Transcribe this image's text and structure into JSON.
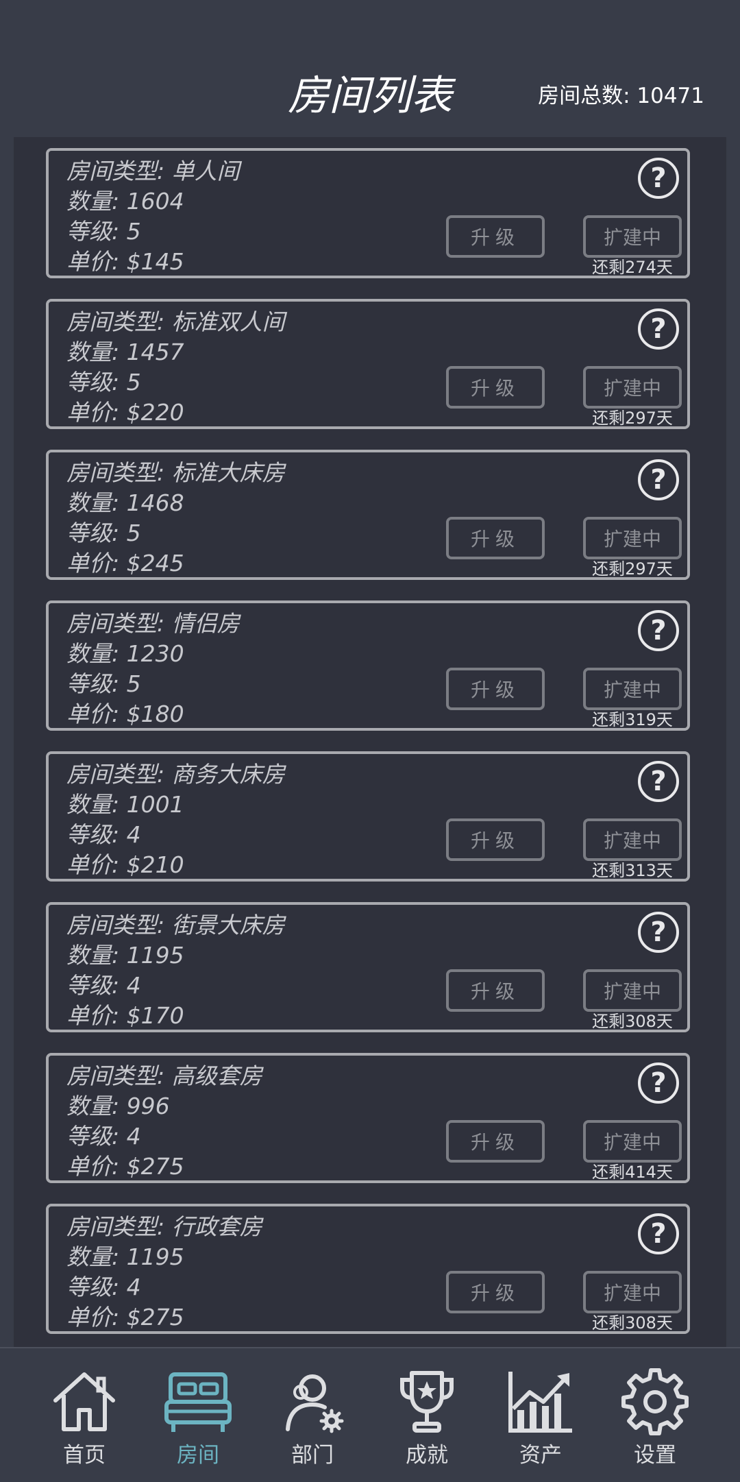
{
  "header": {
    "title": "房间列表",
    "total_text": "房间总数: 10471"
  },
  "buttons": {
    "help": "?",
    "upgrade": "升级",
    "expanding": "扩建中"
  },
  "rooms": [
    {
      "type": "房间类型: 单人间",
      "count": "数量: 1604",
      "level": "等级: 5",
      "price": "单价: $145",
      "days": "还剩274天"
    },
    {
      "type": "房间类型: 标准双人间",
      "count": "数量: 1457",
      "level": "等级: 5",
      "price": "单价: $220",
      "days": "还剩297天"
    },
    {
      "type": "房间类型: 标准大床房",
      "count": "数量: 1468",
      "level": "等级: 5",
      "price": "单价: $245",
      "days": "还剩297天"
    },
    {
      "type": "房间类型: 情侣房",
      "count": "数量: 1230",
      "level": "等级: 5",
      "price": "单价: $180",
      "days": "还剩319天"
    },
    {
      "type": "房间类型: 商务大床房",
      "count": "数量: 1001",
      "level": "等级: 4",
      "price": "单价: $210",
      "days": "还剩313天"
    },
    {
      "type": "房间类型: 街景大床房",
      "count": "数量: 1195",
      "level": "等级: 4",
      "price": "单价: $170",
      "days": "还剩308天"
    },
    {
      "type": "房间类型: 高级套房",
      "count": "数量: 996",
      "level": "等级: 4",
      "price": "单价: $275",
      "days": "还剩414天"
    },
    {
      "type": "房间类型: 行政套房",
      "count": "数量: 1195",
      "level": "等级: 4",
      "price": "单价: $275",
      "days": "还剩308天"
    }
  ],
  "nav": [
    {
      "label": "首页",
      "icon": "home-icon",
      "active": false
    },
    {
      "label": "房间",
      "icon": "bed-icon",
      "active": true
    },
    {
      "label": "部门",
      "icon": "department-icon",
      "active": false
    },
    {
      "label": "成就",
      "icon": "trophy-icon",
      "active": false
    },
    {
      "label": "资产",
      "icon": "assets-chart-icon",
      "active": false
    },
    {
      "label": "设置",
      "icon": "gear-icon",
      "active": false
    }
  ],
  "colors": {
    "background": "#383c48",
    "panel": "#2f313c",
    "active_tab": "#6cb4c2"
  }
}
